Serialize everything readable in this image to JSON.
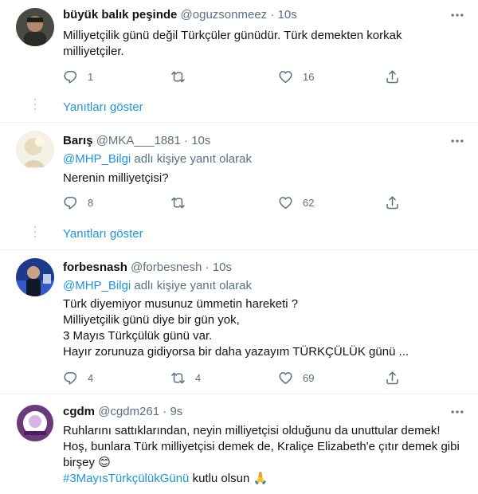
{
  "tweets": [
    {
      "name": "büyük balık peşinde",
      "handle": "@oguzsonmeez",
      "time": "10s",
      "lines": [
        "Milliyetçilik günü değil Türkçüler günüdür. Türk demekten korkak",
        "milliyetçiler."
      ],
      "replies": "1",
      "retweets": "",
      "likes": "16",
      "show_replies": "Yanıtları göster"
    },
    {
      "name": "Barış",
      "handle": "@MKA___1881",
      "time": "10s",
      "reply_mention": "@MHP_Bilgi",
      "reply_suffix": " adlı kişiye yanıt olarak",
      "lines": [
        "Nerenin milliyetçisi?"
      ],
      "replies": "8",
      "retweets": "",
      "likes": "62",
      "show_replies": "Yanıtları göster"
    },
    {
      "name": "forbesnash",
      "handle": "@forbesnesh",
      "time": "10s",
      "reply_mention": "@MHP_Bilgi",
      "reply_suffix": " adlı kişiye yanıt olarak",
      "lines": [
        "Türk diyemiyor musunuz ümmetin hareketi ?",
        "Milliyetçilik günü diye bir gün yok,",
        "3 Mayıs Türkçülük günü var.",
        "Hayır zorunuza gidiyorsa bir daha yazayım TÜRKÇÜLÜK günü ..."
      ],
      "replies": "4",
      "retweets": "4",
      "likes": "69"
    },
    {
      "name": "cgdm",
      "handle": "@cgdm261",
      "time": "9s",
      "lines": [
        "Ruhlarını sattıklarından, neyin milliyetçisi olduğunu da unuttular demek!",
        "Hoş, bunlara Türk milliyetçisi demek de, Kraliçe Elizabeth'e çıtır demek gibi",
        "birşey"
      ],
      "emoji_smile": "😊",
      "hashtag": "#3MayısTürkçülükGünü",
      "hashtag_suffix": " kutlu olsun",
      "emoji_pray": "🙏"
    }
  ],
  "meta_sep": " · ",
  "icons": {
    "reply": "reply-icon",
    "retweet": "retweet-icon",
    "like": "heart-icon",
    "share": "share-icon",
    "more": "more-options-icon"
  },
  "colors": {
    "link": "#1b95e0",
    "secondary": "#5b7083",
    "text": "#0f1419",
    "divider": "#e6ecf0"
  }
}
